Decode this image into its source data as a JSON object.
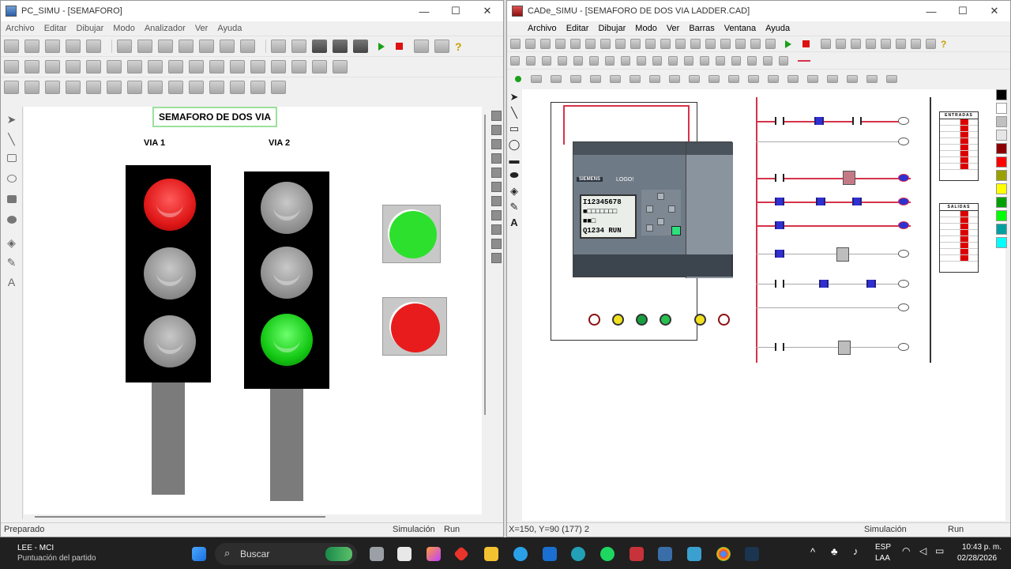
{
  "left_window": {
    "title": "PC_SIMU - [SEMAFORO]",
    "controls": [
      "—",
      "☐",
      "✕"
    ],
    "menu": [
      "Archivo",
      "Editar",
      "Dibujar",
      "Modo",
      "Analizador",
      "Ver",
      "Ayuda"
    ],
    "canvas": {
      "heading": "SEMAFORO DE DOS VIA",
      "via1_label": "VIA 1",
      "via2_label": "VIA 2"
    },
    "status": {
      "left": "Preparado",
      "mode": "Simulación",
      "state": "Run"
    },
    "lamps": {
      "via1": [
        "red",
        "off",
        "off"
      ],
      "via2": [
        "off",
        "off",
        "green"
      ]
    },
    "pilot_colors": {
      "top": "#2ee02e",
      "bottom": "#e81c1c"
    }
  },
  "right_window": {
    "title": "CADe_SIMU - [SEMAFORO DE DOS VIA LADDER.CAD]",
    "controls": [
      "—",
      "☐",
      "✕"
    ],
    "menu": [
      "Archivo",
      "Editar",
      "Dibujar",
      "Modo",
      "Ver",
      "Barras",
      "Ventana",
      "Ayuda"
    ],
    "status": {
      "coords": "X=150, Y=90 (177) 2",
      "mode": "Simulación",
      "state": "Run"
    },
    "plc": {
      "brand": "SIEMENS",
      "model": "LOGO!",
      "lcd_line1": "I12345678",
      "lcd_line2": "■□□□□□□□",
      "lcd_line3": "■■□",
      "lcd_line4": "Q1234 RUN"
    },
    "entradas_title": "ENTRADAS",
    "salidas_title": "SALIDAS",
    "palette": [
      "#000000",
      "#ffffff",
      "#bfbfbf",
      "#e6e6e6",
      "#8b0000",
      "#ff0000",
      "#9aa000",
      "#ffff00",
      "#00a000",
      "#00ff00",
      "#00a0a0",
      "#00ffff"
    ]
  },
  "taskbar": {
    "widget_title": "LEE - MCI",
    "widget_subtitle": "Puntuación del partido",
    "search": "Buscar",
    "lang_top": "ESP",
    "lang_bottom": "LAA",
    "time": "10:43 p. m.",
    "date": "02/28/2026"
  }
}
